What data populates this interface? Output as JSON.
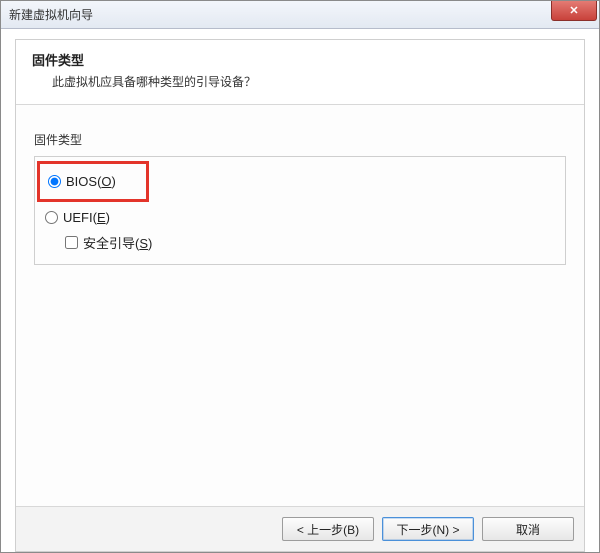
{
  "window": {
    "title": "新建虚拟机向导"
  },
  "header": {
    "title": "固件类型",
    "subtitle": "此虚拟机应具备哪种类型的引导设备？"
  },
  "group": {
    "label": "固件类型"
  },
  "options": {
    "bios": {
      "label": "BIOS(",
      "accel": "O",
      "tail": ")"
    },
    "uefi": {
      "label": "UEFI(",
      "accel": "E",
      "tail": ")"
    },
    "secure_boot": {
      "label": "安全引导(",
      "accel": "S",
      "tail": ")"
    }
  },
  "footer": {
    "back": "< 上一步(B)",
    "next": "下一步(N) >",
    "cancel": "取消"
  }
}
